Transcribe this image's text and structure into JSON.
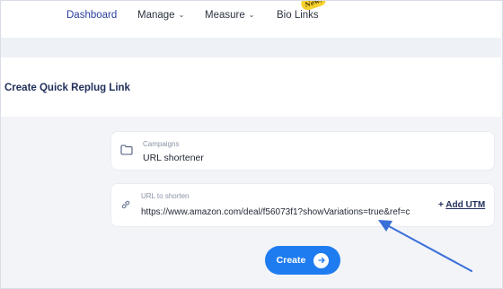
{
  "nav": {
    "items": [
      {
        "label": "Dashboard",
        "has_dropdown": false,
        "active": true
      },
      {
        "label": "Manage",
        "has_dropdown": true,
        "active": false
      },
      {
        "label": "Measure",
        "has_dropdown": true,
        "active": false
      },
      {
        "label": "Bio Links",
        "has_dropdown": false,
        "active": false
      }
    ],
    "badge": "New!"
  },
  "page": {
    "title": "Create Quick Replug Link"
  },
  "form": {
    "campaign": {
      "label": "Campaigns",
      "value": "URL shortener",
      "icon": "folder-icon"
    },
    "url": {
      "label": "URL to shorten",
      "value": "https://www.amazon.com/deal/f56073f1?showVariations=true&ref=c",
      "icon": "link-icon"
    },
    "add_utm": {
      "prefix": "+",
      "label": "Add UTM"
    },
    "create_button": {
      "label": "Create",
      "icon": "arrow-right-icon"
    }
  },
  "colors": {
    "accent": "#1f7cf0",
    "nav_active": "#2b3fa0",
    "title": "#1f2d5a",
    "badge": "#f6d12f",
    "annotation_arrow": "#3b6fd8"
  }
}
